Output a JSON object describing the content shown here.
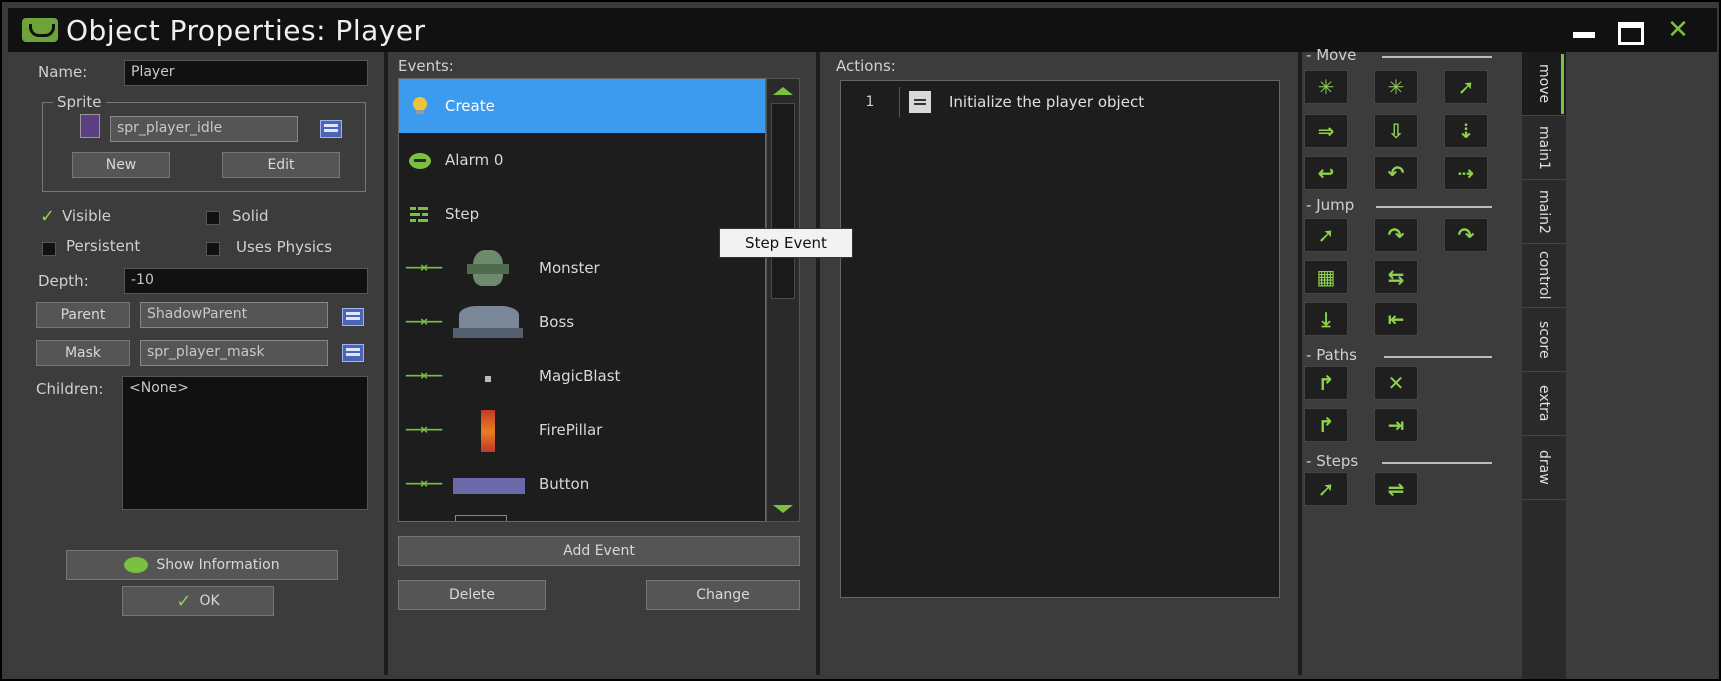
{
  "window": {
    "title": "Object Properties: Player",
    "controls": {
      "minimize": "",
      "maximize": "",
      "close": "✕"
    }
  },
  "left": {
    "name_label": "Name:",
    "name_value": "Player",
    "sprite_group": "Sprite",
    "sprite_value": "spr_player_idle",
    "new_button": "New",
    "edit_button": "Edit",
    "visible_label": "Visible",
    "solid_label": "Solid",
    "persistent_label": "Persistent",
    "physics_label": "Uses Physics",
    "depth_label": "Depth:",
    "depth_value": "-10",
    "parent_button": "Parent",
    "parent_value": "ShadowParent",
    "mask_button": "Mask",
    "mask_value": "spr_player_mask",
    "children_label": "Children:",
    "children_value": "<None>",
    "show_info_button": "Show Information",
    "ok_button": "OK",
    "checkbox_states": {
      "visible": true,
      "solid": false,
      "persistent": false,
      "physics": false
    }
  },
  "events": {
    "label": "Events:",
    "items": [
      {
        "label": "Create",
        "selected": true
      },
      {
        "label": "Alarm 0"
      },
      {
        "label": "Step"
      },
      {
        "label": "Monster"
      },
      {
        "label": "Boss"
      },
      {
        "label": "MagicBlast"
      },
      {
        "label": "FirePillar"
      },
      {
        "label": "Button"
      }
    ],
    "tooltip": "Step Event",
    "add_event_button": "Add Event",
    "delete_button": "Delete",
    "change_button": "Change"
  },
  "actions": {
    "label": "Actions:",
    "items": [
      {
        "number": "1",
        "text": "Initialize the player object"
      }
    ]
  },
  "library": {
    "sections": [
      "Move",
      "Jump",
      "Paths",
      "Steps"
    ],
    "tabs": [
      "move",
      "main1",
      "main2",
      "control",
      "score",
      "extra",
      "draw"
    ]
  },
  "colors": {
    "accent_green": "#7cc042",
    "selection_blue": "#3c9bef",
    "background": "#3c3c3c"
  }
}
